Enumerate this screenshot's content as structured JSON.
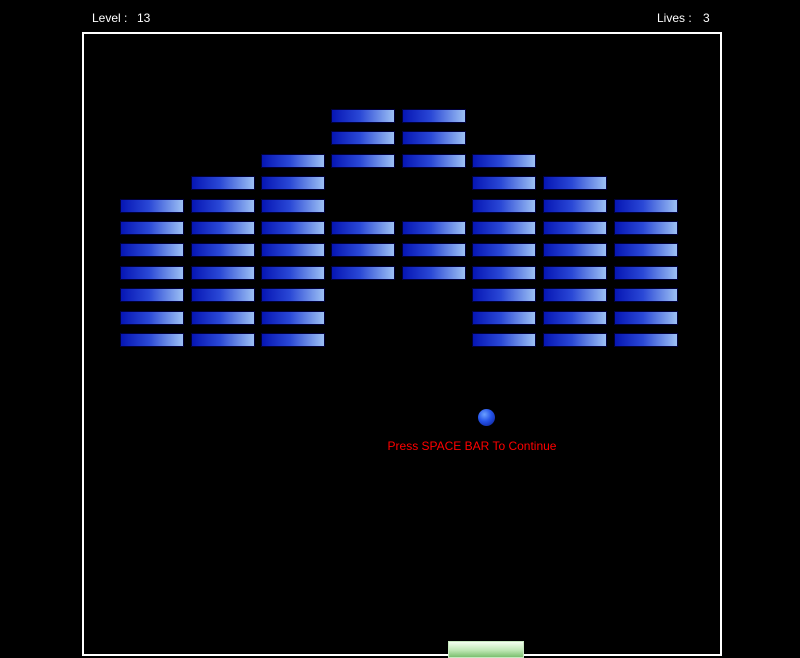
{
  "hud": {
    "level_label": "Level :",
    "level_value": "13",
    "lives_label": "Lives :",
    "lives_value": "3"
  },
  "message": {
    "text": "Press SPACE BAR To Continue",
    "color": "#ff0000"
  },
  "bricks": {
    "rows": [
      [
        0,
        0,
        0,
        1,
        1,
        0,
        0,
        0
      ],
      [
        0,
        0,
        0,
        1,
        1,
        0,
        0,
        0
      ],
      [
        0,
        0,
        1,
        1,
        1,
        1,
        0,
        0
      ],
      [
        0,
        1,
        1,
        0,
        0,
        1,
        1,
        0
      ],
      [
        1,
        1,
        1,
        0,
        0,
        1,
        1,
        1
      ],
      [
        1,
        1,
        1,
        1,
        1,
        1,
        1,
        1
      ],
      [
        1,
        1,
        1,
        1,
        1,
        1,
        1,
        1
      ],
      [
        1,
        1,
        1,
        1,
        1,
        1,
        1,
        1
      ],
      [
        1,
        1,
        1,
        0,
        0,
        1,
        1,
        1
      ],
      [
        1,
        1,
        1,
        0,
        0,
        1,
        1,
        1
      ],
      [
        1,
        1,
        1,
        0,
        0,
        1,
        1,
        1
      ]
    ],
    "color_dark": "#0616b4",
    "color_light": "#9cc0f4"
  },
  "ball": {
    "color": "#2452e8"
  },
  "paddle": {
    "color": "#bfe8b4"
  }
}
